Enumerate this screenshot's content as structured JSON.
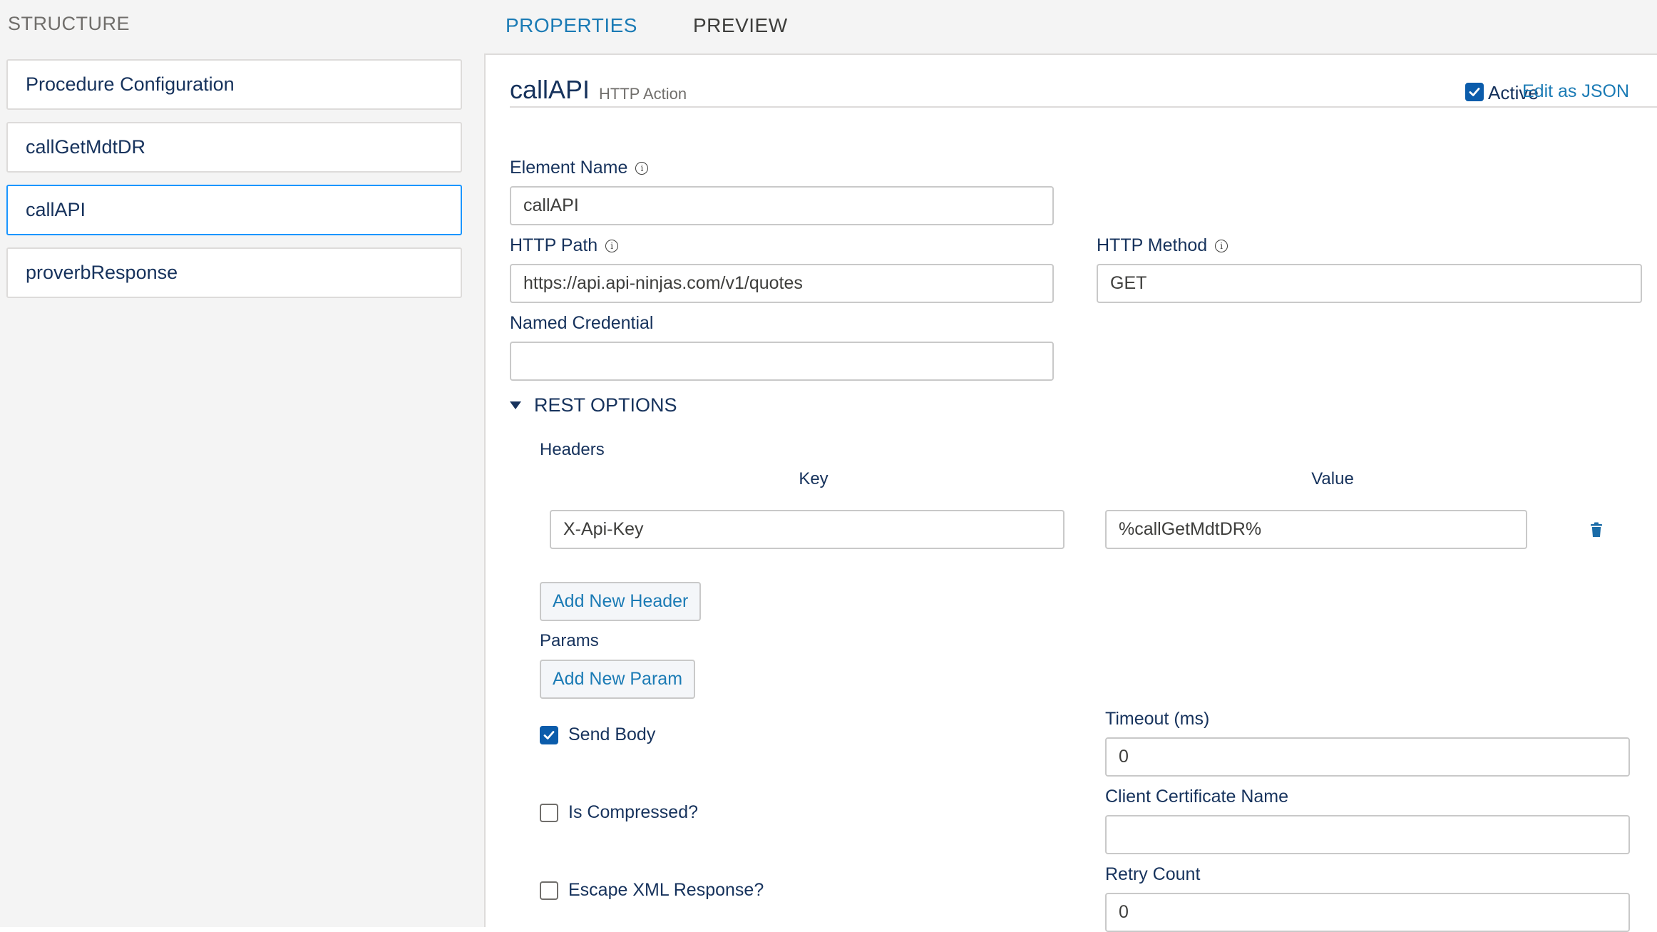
{
  "structure": {
    "title": "STRUCTURE",
    "items": [
      {
        "label": "Procedure Configuration"
      },
      {
        "label": "callGetMdtDR"
      },
      {
        "label": "callAPI"
      },
      {
        "label": "proverbResponse"
      }
    ]
  },
  "tabs": {
    "properties": "PROPERTIES",
    "preview": "PREVIEW"
  },
  "header": {
    "element_name": "callAPI",
    "element_type": "HTTP Action",
    "active_label": "Active",
    "active_checked": true,
    "edit_json": "Edit as JSON"
  },
  "fields": {
    "element_name": {
      "label": "Element Name",
      "value": "callAPI"
    },
    "http_path": {
      "label": "HTTP Path",
      "value": "https://api.api-ninjas.com/v1/quotes"
    },
    "http_method": {
      "label": "HTTP Method",
      "value": "GET"
    },
    "named_credential": {
      "label": "Named Credential",
      "value": ""
    }
  },
  "rest_options": {
    "label": "REST OPTIONS",
    "headers_label": "Headers",
    "key_column": "Key",
    "value_column": "Value",
    "header_rows": [
      {
        "key": "X-Api-Key",
        "value": "%callGetMdtDR%"
      }
    ],
    "add_header": "Add New Header",
    "params_label": "Params",
    "add_param": "Add New Param",
    "send_body": {
      "label": "Send Body",
      "checked": true
    },
    "is_compressed": {
      "label": "Is Compressed?",
      "checked": false
    },
    "escape_xml": {
      "label": "Escape XML Response?",
      "checked": false
    },
    "timeout": {
      "label": "Timeout (ms)",
      "value": "0"
    },
    "client_cert": {
      "label": "Client Certificate Name",
      "value": ""
    },
    "retry_count": {
      "label": "Retry Count",
      "value": "0"
    }
  },
  "colors": {
    "accent": "#1b7bb5",
    "checkbox_checked": "#0b5cab",
    "selected_border": "#1b96ff"
  }
}
